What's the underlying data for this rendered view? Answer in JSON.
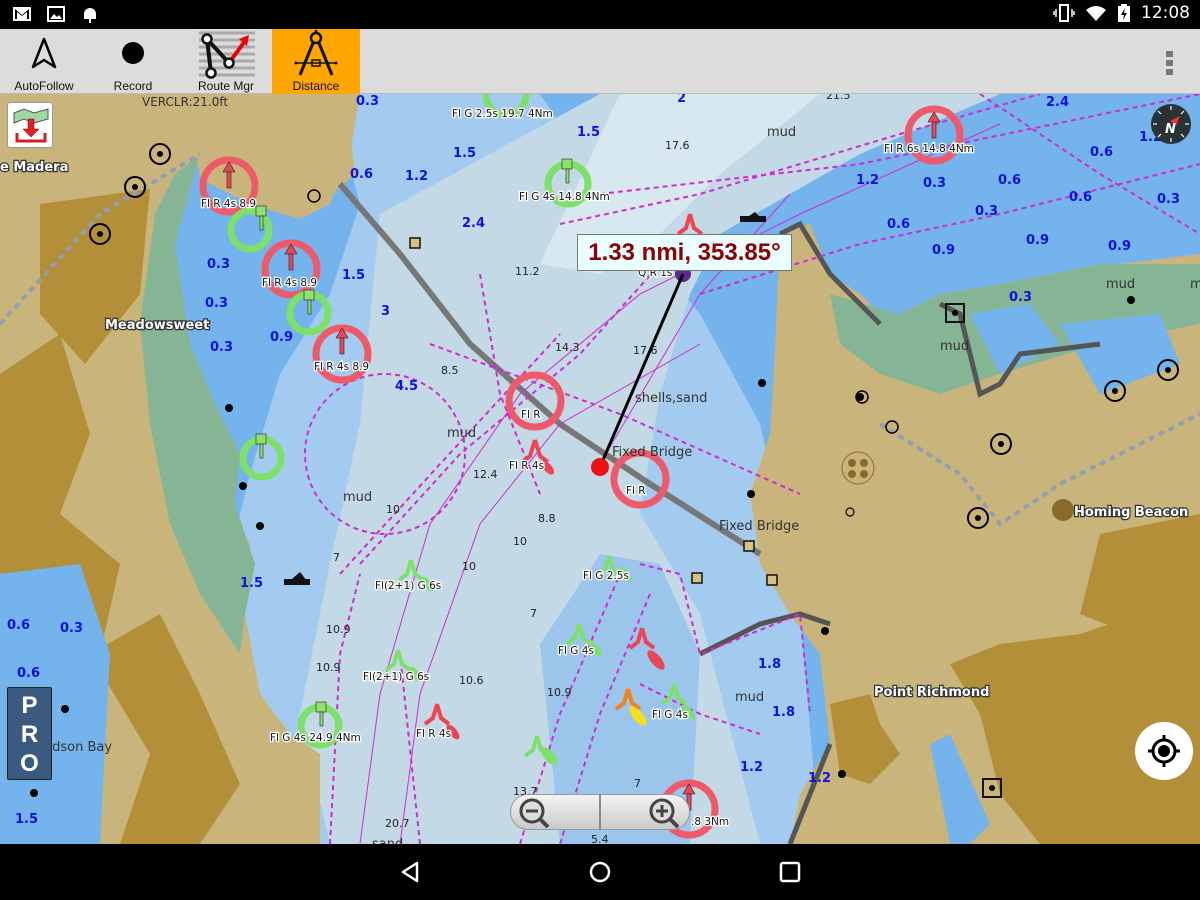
{
  "status_bar": {
    "left_icons": [
      "gmail-icon",
      "gallery-icon",
      "android-debug-icon"
    ],
    "right_icons": [
      "vibrate-icon",
      "wifi-icon",
      "battery-charging-icon"
    ],
    "time": "12:08"
  },
  "toolbar": {
    "tools": [
      {
        "label": "AutoFollow",
        "icon": "navigation-arrow-icon",
        "active": false
      },
      {
        "label": "Record",
        "icon": "record-dot-icon",
        "active": false
      },
      {
        "label": "Route Mgr",
        "icon": "route-icon",
        "active": false
      },
      {
        "label": "Distance",
        "icon": "compass-dividers-icon",
        "active": true
      }
    ],
    "overflow_icon": "overflow-menu-icon",
    "active_color": "#ffa500"
  },
  "map": {
    "measurement": "1.33 nmi, 353.85°",
    "vertical_clearance": "VERCLR:21.0ft",
    "place_names": [
      "e Madera",
      "Meadowsweet",
      "Homing Beacon",
      "Point Richmond"
    ],
    "plain_labels": [
      "Richardson Bay",
      "Fixed Bridge",
      "Fixed Bridge",
      "shells,sand",
      "mud",
      "mud",
      "mud",
      "mud",
      "mud",
      "mud",
      "mud",
      "sand"
    ],
    "depths_blue": [
      "0.3",
      "1.5",
      "1.5",
      "1.2",
      "2",
      "0.6",
      "2.4",
      "0.3",
      "1.5",
      "0.3",
      "3",
      "0.3",
      "0.9",
      "4.5",
      "1.2",
      "0.3",
      "0.6",
      "0.3",
      "0.9",
      "0.6",
      "0.9",
      "0.3",
      "0.6",
      "0.6",
      "0.3",
      "0.9",
      "2.4",
      "1.2",
      "0.3",
      "1.5",
      "0.6",
      "0.6",
      "1.5",
      "1.8",
      "1.8",
      "1.2",
      "1.2"
    ],
    "soundings": [
      "17.6",
      "11.2",
      "14.3",
      "17.6",
      "8.5",
      "12.4",
      "8.8",
      "10",
      "10",
      "10",
      "7",
      "10.9",
      "10.9",
      "10.6",
      "7",
      "10.9",
      "13.7",
      "7",
      "20.7",
      "5.4",
      "21.5"
    ],
    "light_labels": [
      "Fl G 2.5s 19.7 4Nm",
      "Fl G 4s 14.8 4Nm",
      "Fl R 6s 14.8 4Nm",
      "Fl R 4s 8.9",
      "Fl R 4s 8.9",
      "Fl R 4s 8.9",
      "Fl R",
      "Fl R",
      "Fl R 4s",
      "Q R 1s",
      "Fl G 2.5s",
      "Fl(2+1) G 6s",
      "Fl(2+1) G 6s",
      "Fl G 4s",
      "Fl G 4s",
      "Fl R 4s",
      "Fl G 4s 24.9 4Nm",
      ".8 3Nm"
    ],
    "pro_badge": [
      "P",
      "R",
      "O"
    ],
    "download_icon": "chart-download-icon",
    "compass_icon": "north-compass-icon",
    "locate_icon": "my-location-icon",
    "zoom_out_icon": "zoom-out-icon",
    "zoom_in_icon": "zoom-in-icon",
    "colors": {
      "deep_water": "#74b3ec",
      "shallow_water": "#a3cbef",
      "channel": "#c4d9e6",
      "land": "#c9b57c",
      "built_up": "#b38f3a",
      "intertidal": "#86b596",
      "measurement_text": "#8b0000",
      "red_light": "#ee5a6a",
      "green_light": "#7de06a"
    }
  },
  "nav_bar": {
    "buttons": [
      "back-icon",
      "home-icon",
      "recents-icon"
    ]
  }
}
